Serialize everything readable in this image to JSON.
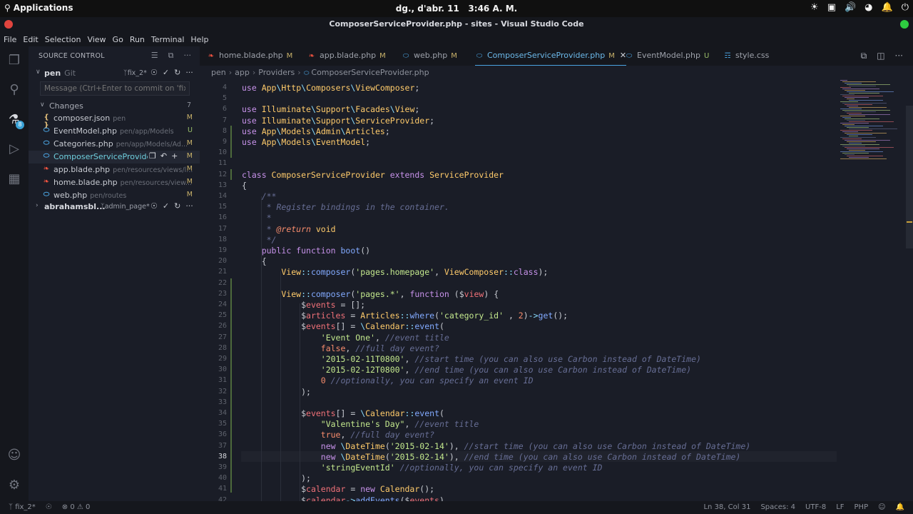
{
  "topbar": {
    "activities": "Applications",
    "clock_date": "dg., d'abr. 11",
    "clock_time": "3:46 A. M."
  },
  "window": {
    "title": "ComposerServiceProvider.php - sites - Visual Studio Code"
  },
  "menu": [
    "File",
    "Edit",
    "Selection",
    "View",
    "Go",
    "Run",
    "Terminal",
    "Help"
  ],
  "activity": {
    "scm_badge": "8"
  },
  "sidebar": {
    "title": "SOURCE CONTROL",
    "repos": [
      {
        "name": "pen",
        "provider": "Git",
        "branch": "fix_2*"
      },
      {
        "name": "abrahamsbl...",
        "provider": "",
        "branch": "admin_page*"
      }
    ],
    "commit_placeholder": "Message (Ctrl+Enter to commit on 'fix_2')",
    "changes_label": "Changes",
    "changes_count": "7",
    "files": [
      {
        "name": "composer.json",
        "path": "pen",
        "status": "M",
        "icon": "{ }",
        "icon_color": "#e5c07b",
        "status_color": "#c9b26a"
      },
      {
        "name": "EventModel.php",
        "path": "pen/app/Models",
        "status": "U",
        "icon": "php-icon",
        "icon_color": "#4aa3e0",
        "status_color": "#9bbf6a"
      },
      {
        "name": "Categories.php",
        "path": "pen/app/Models/Ad...",
        "status": "M",
        "icon": "php-icon",
        "icon_color": "#4aa3e0",
        "status_color": "#c9b26a"
      },
      {
        "name": "ComposerServiceProvide...",
        "path": "",
        "status": "M",
        "icon": "php-icon",
        "icon_color": "#4aa3e0",
        "status_color": "#c9b26a"
      },
      {
        "name": "app.blade.php",
        "path": "pen/resources/views/l...",
        "status": "M",
        "icon": "blade-icon",
        "icon_color": "#f05340",
        "status_color": "#c9b26a"
      },
      {
        "name": "home.blade.php",
        "path": "pen/resources/view...",
        "status": "M",
        "icon": "blade-icon",
        "icon_color": "#f05340",
        "status_color": "#c9b26a"
      },
      {
        "name": "web.php",
        "path": "pen/routes",
        "status": "M",
        "icon": "php-icon",
        "icon_color": "#4aa3e0",
        "status_color": "#c9b26a"
      }
    ]
  },
  "tabs": [
    {
      "name": "home.blade.php",
      "status": "M",
      "icon": "blade-icon",
      "icon_color": "#f05340",
      "status_color": "#c9b26a",
      "active": false
    },
    {
      "name": "app.blade.php",
      "status": "M",
      "icon": "blade-icon",
      "icon_color": "#f05340",
      "status_color": "#c9b26a",
      "active": false
    },
    {
      "name": "web.php",
      "status": "M",
      "icon": "php-icon",
      "icon_color": "#4aa3e0",
      "status_color": "#c9b26a",
      "active": false
    },
    {
      "name": "ComposerServiceProvider.php",
      "status": "M",
      "icon": "php-icon",
      "icon_color": "#4aa3e0",
      "status_color": "#c9b26a",
      "active": true
    },
    {
      "name": "EventModel.php",
      "status": "U",
      "icon": "php-icon",
      "icon_color": "#4aa3e0",
      "status_color": "#9bbf6a",
      "active": false
    },
    {
      "name": "style.css",
      "status": "",
      "icon": "css-icon",
      "icon_color": "#4aa3e0",
      "status_color": "#c9b26a",
      "active": false
    }
  ],
  "breadcrumb": [
    "pen",
    "app",
    "Providers",
    "ComposerServiceProvider.php"
  ],
  "editor": {
    "current_line": 38,
    "lines": [
      {
        "n": 4,
        "t": [
          [
            "kw",
            "use "
          ],
          [
            "cls",
            "App"
          ],
          [
            "pu",
            "\\"
          ],
          [
            "cls",
            "Http"
          ],
          [
            "pu",
            "\\"
          ],
          [
            "cls",
            "Composers"
          ],
          [
            "pu",
            "\\"
          ],
          [
            "cls",
            "ViewComposer"
          ],
          [
            "dl",
            ";"
          ]
        ]
      },
      {
        "n": 5,
        "t": []
      },
      {
        "n": 6,
        "t": [
          [
            "kw",
            "use "
          ],
          [
            "cls",
            "Illuminate"
          ],
          [
            "pu",
            "\\"
          ],
          [
            "cls",
            "Support"
          ],
          [
            "pu",
            "\\"
          ],
          [
            "cls",
            "Facades"
          ],
          [
            "pu",
            "\\"
          ],
          [
            "cls",
            "View"
          ],
          [
            "dl",
            ";"
          ]
        ]
      },
      {
        "n": 7,
        "t": [
          [
            "kw",
            "use "
          ],
          [
            "cls",
            "Illuminate"
          ],
          [
            "pu",
            "\\"
          ],
          [
            "cls",
            "Support"
          ],
          [
            "pu",
            "\\"
          ],
          [
            "cls",
            "ServiceProvider"
          ],
          [
            "dl",
            ";"
          ]
        ]
      },
      {
        "n": 8,
        "t": [
          [
            "kw",
            "use "
          ],
          [
            "cls",
            "App"
          ],
          [
            "pu",
            "\\"
          ],
          [
            "cls",
            "Models"
          ],
          [
            "pu",
            "\\"
          ],
          [
            "cls",
            "Admin"
          ],
          [
            "pu",
            "\\"
          ],
          [
            "cls",
            "Articles"
          ],
          [
            "dl",
            ";"
          ]
        ]
      },
      {
        "n": 9,
        "t": [
          [
            "kw",
            "use "
          ],
          [
            "cls",
            "App"
          ],
          [
            "pu",
            "\\"
          ],
          [
            "cls",
            "Models"
          ],
          [
            "pu",
            "\\"
          ],
          [
            "cls",
            "EventModel"
          ],
          [
            "dl",
            ";"
          ]
        ]
      },
      {
        "n": 10,
        "t": []
      },
      {
        "n": 11,
        "t": []
      },
      {
        "n": 12,
        "t": [
          [
            "kw",
            "class "
          ],
          [
            "cls",
            "ComposerServiceProvider "
          ],
          [
            "kw",
            "extends "
          ],
          [
            "cls",
            "ServiceProvider"
          ]
        ]
      },
      {
        "n": 13,
        "t": [
          [
            "dl",
            "{"
          ]
        ]
      },
      {
        "n": 14,
        "t": [
          [
            "cm",
            "    /**"
          ]
        ]
      },
      {
        "n": 15,
        "t": [
          [
            "cm",
            "     * Register bindings in the container."
          ]
        ]
      },
      {
        "n": 16,
        "t": [
          [
            "cm",
            "     *"
          ]
        ]
      },
      {
        "n": 17,
        "t": [
          [
            "cm",
            "     * "
          ],
          [
            "cmt",
            "@return"
          ],
          [
            "cm",
            " "
          ],
          [
            "cls",
            "void"
          ]
        ]
      },
      {
        "n": 18,
        "t": [
          [
            "cm",
            "     */"
          ]
        ]
      },
      {
        "n": 19,
        "t": [
          [
            "dl",
            "    "
          ],
          [
            "kw",
            "public function "
          ],
          [
            "fn",
            "boot"
          ],
          [
            "dl",
            "()"
          ]
        ]
      },
      {
        "n": 20,
        "t": [
          [
            "dl",
            "    {"
          ]
        ]
      },
      {
        "n": 21,
        "t": [
          [
            "dl",
            "        "
          ],
          [
            "cls",
            "View"
          ],
          [
            "pu",
            "::"
          ],
          [
            "fn",
            "composer"
          ],
          [
            "dl",
            "("
          ],
          [
            "str",
            "'pages.homepage'"
          ],
          [
            "dl",
            ", "
          ],
          [
            "cls",
            "ViewComposer"
          ],
          [
            "pu",
            "::"
          ],
          [
            "kw",
            "class"
          ],
          [
            "dl",
            ");"
          ]
        ]
      },
      {
        "n": 22,
        "t": []
      },
      {
        "n": 23,
        "t": [
          [
            "dl",
            "        "
          ],
          [
            "cls",
            "View"
          ],
          [
            "pu",
            "::"
          ],
          [
            "fn",
            "composer"
          ],
          [
            "dl",
            "("
          ],
          [
            "str",
            "'pages.*'"
          ],
          [
            "dl",
            ", "
          ],
          [
            "kw",
            "function "
          ],
          [
            "dl",
            "("
          ],
          [
            "dl",
            "$"
          ],
          [
            "var",
            "view"
          ],
          [
            "dl",
            ") {"
          ]
        ]
      },
      {
        "n": 24,
        "t": [
          [
            "dl",
            "            $"
          ],
          [
            "var",
            "events"
          ],
          [
            "dl",
            " = [];"
          ]
        ]
      },
      {
        "n": 25,
        "t": [
          [
            "dl",
            "            $"
          ],
          [
            "var",
            "articles"
          ],
          [
            "dl",
            " = "
          ],
          [
            "cls",
            "Articles"
          ],
          [
            "pu",
            "::"
          ],
          [
            "fn",
            "where"
          ],
          [
            "dl",
            "("
          ],
          [
            "str",
            "'category_id'"
          ],
          [
            "dl",
            " , "
          ],
          [
            "num",
            "2"
          ],
          [
            "dl",
            ")"
          ],
          [
            "pu",
            "->"
          ],
          [
            "fn",
            "get"
          ],
          [
            "dl",
            "();"
          ]
        ]
      },
      {
        "n": 26,
        "t": [
          [
            "dl",
            "            $"
          ],
          [
            "var",
            "events"
          ],
          [
            "dl",
            "[] = "
          ],
          [
            "pu",
            "\\"
          ],
          [
            "cls",
            "Calendar"
          ],
          [
            "pu",
            "::"
          ],
          [
            "fn",
            "event"
          ],
          [
            "dl",
            "("
          ]
        ]
      },
      {
        "n": 27,
        "t": [
          [
            "dl",
            "                "
          ],
          [
            "str",
            "'Event One'"
          ],
          [
            "dl",
            ", "
          ],
          [
            "cm",
            "//event title"
          ]
        ]
      },
      {
        "n": 28,
        "t": [
          [
            "dl",
            "                "
          ],
          [
            "num",
            "false"
          ],
          [
            "dl",
            ", "
          ],
          [
            "cm",
            "//full day event?"
          ]
        ]
      },
      {
        "n": 29,
        "t": [
          [
            "dl",
            "                "
          ],
          [
            "str",
            "'2015-02-11T0800'"
          ],
          [
            "dl",
            ", "
          ],
          [
            "cm",
            "//start time (you can also use Carbon instead of DateTime)"
          ]
        ]
      },
      {
        "n": 30,
        "t": [
          [
            "dl",
            "                "
          ],
          [
            "str",
            "'2015-02-12T0800'"
          ],
          [
            "dl",
            ", "
          ],
          [
            "cm",
            "//end time (you can also use Carbon instead of DateTime)"
          ]
        ]
      },
      {
        "n": 31,
        "t": [
          [
            "dl",
            "                "
          ],
          [
            "num",
            "0"
          ],
          [
            "dl",
            " "
          ],
          [
            "cm",
            "//optionally, you can specify an event ID"
          ]
        ]
      },
      {
        "n": 32,
        "t": [
          [
            "dl",
            "            );"
          ]
        ]
      },
      {
        "n": 33,
        "t": []
      },
      {
        "n": 34,
        "t": [
          [
            "dl",
            "            $"
          ],
          [
            "var",
            "events"
          ],
          [
            "dl",
            "[] = "
          ],
          [
            "pu",
            "\\"
          ],
          [
            "cls",
            "Calendar"
          ],
          [
            "pu",
            "::"
          ],
          [
            "fn",
            "event"
          ],
          [
            "dl",
            "("
          ]
        ]
      },
      {
        "n": 35,
        "t": [
          [
            "dl",
            "                "
          ],
          [
            "str",
            "\"Valentine's Day\""
          ],
          [
            "dl",
            ", "
          ],
          [
            "cm",
            "//event title"
          ]
        ]
      },
      {
        "n": 36,
        "t": [
          [
            "dl",
            "                "
          ],
          [
            "num",
            "true"
          ],
          [
            "dl",
            ", "
          ],
          [
            "cm",
            "//full day event?"
          ]
        ]
      },
      {
        "n": 37,
        "t": [
          [
            "dl",
            "                "
          ],
          [
            "kw",
            "new "
          ],
          [
            "pu",
            "\\"
          ],
          [
            "cls",
            "DateTime"
          ],
          [
            "dl",
            "("
          ],
          [
            "str",
            "'2015-02-14'"
          ],
          [
            "dl",
            "), "
          ],
          [
            "cm",
            "//start time (you can also use Carbon instead of DateTime)"
          ]
        ]
      },
      {
        "n": 38,
        "t": [
          [
            "dl",
            "                "
          ],
          [
            "kw",
            "new "
          ],
          [
            "pu",
            "\\"
          ],
          [
            "cls",
            "DateTime"
          ],
          [
            "dl",
            "("
          ],
          [
            "str",
            "'2015-02-14'"
          ],
          [
            "dl",
            "), "
          ],
          [
            "cm",
            "//end time (you can also use Carbon instead of DateTime)"
          ]
        ]
      },
      {
        "n": 39,
        "t": [
          [
            "dl",
            "                "
          ],
          [
            "str",
            "'stringEventId'"
          ],
          [
            "dl",
            " "
          ],
          [
            "cm",
            "//optionally, you can specify an event ID"
          ]
        ]
      },
      {
        "n": 40,
        "t": [
          [
            "dl",
            "            );"
          ]
        ]
      },
      {
        "n": 41,
        "t": [
          [
            "dl",
            "            $"
          ],
          [
            "var",
            "calendar"
          ],
          [
            "dl",
            " = "
          ],
          [
            "kw",
            "new "
          ],
          [
            "cls",
            "Calendar"
          ],
          [
            "dl",
            "();"
          ]
        ]
      },
      {
        "n": 42,
        "t": [
          [
            "dl",
            "            $"
          ],
          [
            "var",
            "calendar"
          ],
          [
            "pu",
            "->"
          ],
          [
            "fn",
            "addEvents"
          ],
          [
            "dl",
            "($"
          ],
          [
            "var",
            "events"
          ],
          [
            "dl",
            ")"
          ]
        ]
      }
    ]
  },
  "status": {
    "branch": "fix_2*",
    "errors": "0",
    "warnings": "0",
    "position": "Ln 38, Col 31",
    "spaces": "Spaces: 4",
    "encoding": "UTF-8",
    "eol": "LF",
    "language": "PHP"
  },
  "colors": {
    "accent": "#4aa3e0",
    "modified": "#c9b26a",
    "untracked": "#9bbf6a"
  }
}
